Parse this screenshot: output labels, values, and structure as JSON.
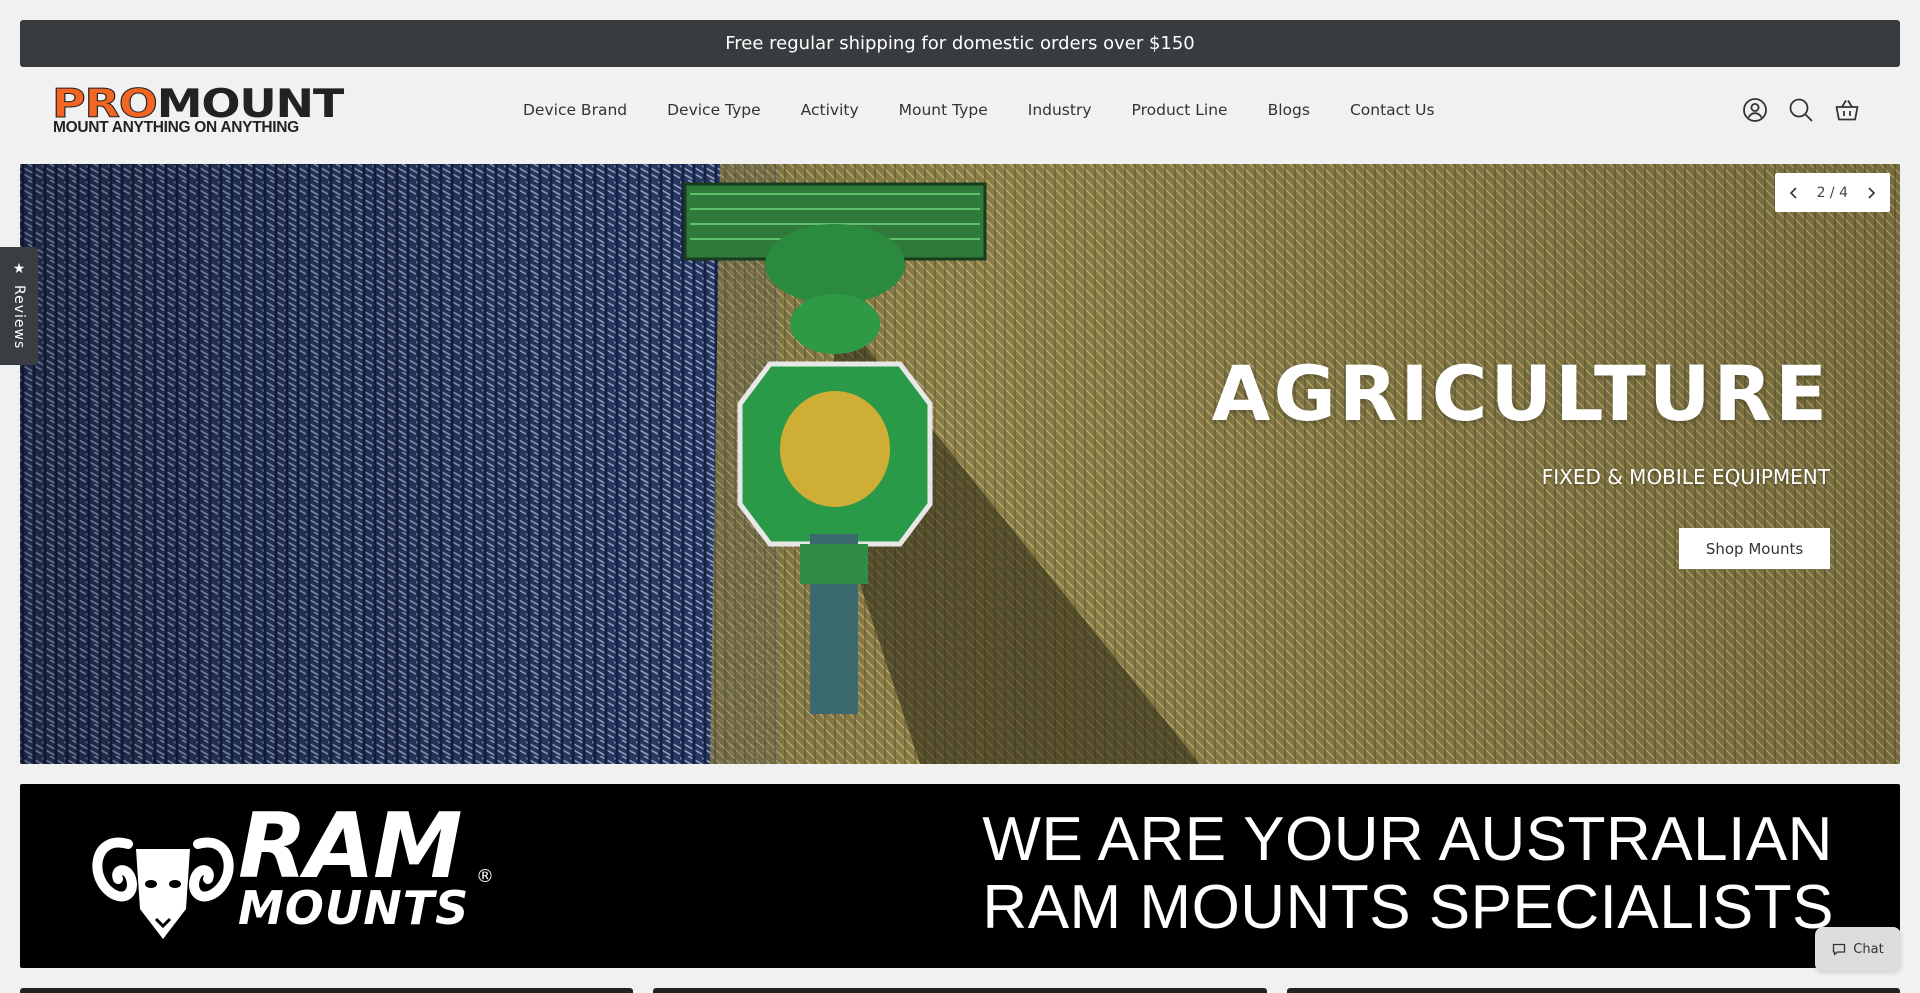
{
  "announcement": {
    "text": "Free regular shipping for domestic orders over $150"
  },
  "logo": {
    "word_part1": "PRO",
    "word_part2": "MOUNT",
    "tagline": "MOUNT ANYTHING ON ANYTHING"
  },
  "nav": {
    "items": [
      {
        "label": "Device Brand"
      },
      {
        "label": "Device Type"
      },
      {
        "label": "Activity"
      },
      {
        "label": "Mount Type"
      },
      {
        "label": "Industry"
      },
      {
        "label": "Product Line"
      },
      {
        "label": "Blogs"
      },
      {
        "label": "Contact Us"
      }
    ]
  },
  "header_icons": [
    "account-icon",
    "search-icon",
    "cart-icon"
  ],
  "hero": {
    "title": "AGRICULTURE",
    "subtitle": "FIXED & MOBILE EQUIPMENT",
    "cta_label": "Shop Mounts",
    "pager": {
      "current": 2,
      "total": 4,
      "text": "2 / 4"
    }
  },
  "reviews_tab": {
    "label": "Reviews"
  },
  "ram_banner": {
    "brand": "RAM",
    "brand_sub": "MOUNTS",
    "reg_mark": "®",
    "headline_line1": "WE ARE YOUR AUSTRALIAN",
    "headline_line2": "RAM MOUNTS SPECIALISTS"
  },
  "chat": {
    "label": "Chat"
  },
  "colors": {
    "brand_orange": "#f26522",
    "announce_bg": "#383c3f",
    "text_dark": "#333333"
  }
}
